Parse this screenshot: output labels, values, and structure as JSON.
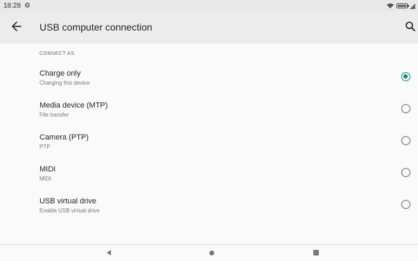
{
  "status_bar": {
    "time": "18:28",
    "icons": [
      "gear-icon",
      "wifi-icon",
      "battery-icon",
      "signal-icon"
    ]
  },
  "app_bar": {
    "title": "USB computer connection",
    "back_icon": "arrow-left-icon",
    "search_icon": "search-icon"
  },
  "section": {
    "header": "CONNECT AS"
  },
  "options": [
    {
      "label": "Charge only",
      "sub": "Charging this device",
      "selected": true
    },
    {
      "label": "Media device (MTP)",
      "sub": "File transfer",
      "selected": false
    },
    {
      "label": "Camera (PTP)",
      "sub": "PTP",
      "selected": false
    },
    {
      "label": "MIDI",
      "sub": "MIDI",
      "selected": false
    },
    {
      "label": "USB virtual drive",
      "sub": "Enable USB virtual drive",
      "selected": false
    }
  ],
  "nav_bar": {
    "icons": [
      "back-triangle-icon",
      "home-circle-icon",
      "recents-square-icon"
    ]
  },
  "colors": {
    "accent": "#00897b",
    "app_bar_bg": "#ececec",
    "page_bg": "#fafafa"
  }
}
